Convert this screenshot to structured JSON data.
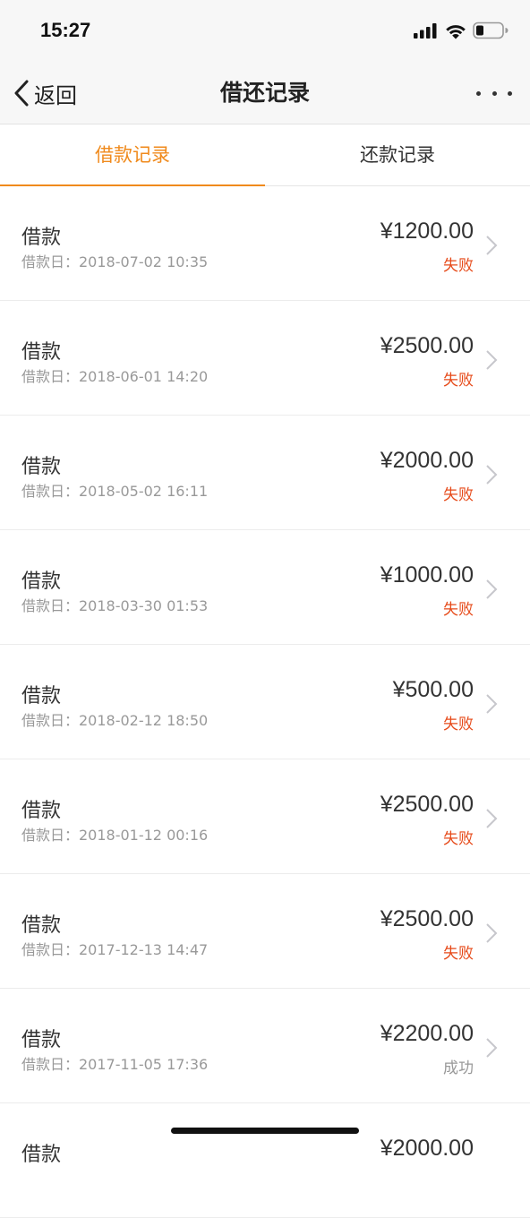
{
  "status_bar": {
    "time": "15:27",
    "icons": [
      "signal-icon",
      "wifi-icon",
      "battery-icon"
    ]
  },
  "nav": {
    "back_label": "返回",
    "title": "借还记录",
    "more_icon": "more-icon"
  },
  "tabs": [
    {
      "label": "借款记录",
      "active": true
    },
    {
      "label": "还款记录",
      "active": false
    }
  ],
  "colors": {
    "accent": "#f08a1c",
    "fail": "#e64a19",
    "muted": "#999999"
  },
  "records": [
    {
      "title": "借款",
      "date": "借款日：2018-07-02 10:35",
      "amount": "¥1200.00",
      "status": "失败",
      "status_type": "fail"
    },
    {
      "title": "借款",
      "date": "借款日：2018-06-01 14:20",
      "amount": "¥2500.00",
      "status": "失败",
      "status_type": "fail"
    },
    {
      "title": "借款",
      "date": "借款日：2018-05-02 16:11",
      "amount": "¥2000.00",
      "status": "失败",
      "status_type": "fail"
    },
    {
      "title": "借款",
      "date": "借款日：2018-03-30 01:53",
      "amount": "¥1000.00",
      "status": "失败",
      "status_type": "fail"
    },
    {
      "title": "借款",
      "date": "借款日：2018-02-12 18:50",
      "amount": "¥500.00",
      "status": "失败",
      "status_type": "fail"
    },
    {
      "title": "借款",
      "date": "借款日：2018-01-12 00:16",
      "amount": "¥2500.00",
      "status": "失败",
      "status_type": "fail"
    },
    {
      "title": "借款",
      "date": "借款日：2017-12-13 14:47",
      "amount": "¥2500.00",
      "status": "失败",
      "status_type": "fail"
    },
    {
      "title": "借款",
      "date": "借款日：2017-11-05 17:36",
      "amount": "¥2200.00",
      "status": "成功",
      "status_type": "ok"
    },
    {
      "title": "借款",
      "date": "",
      "amount": "¥2000.00",
      "status": "",
      "status_type": "ok"
    }
  ]
}
